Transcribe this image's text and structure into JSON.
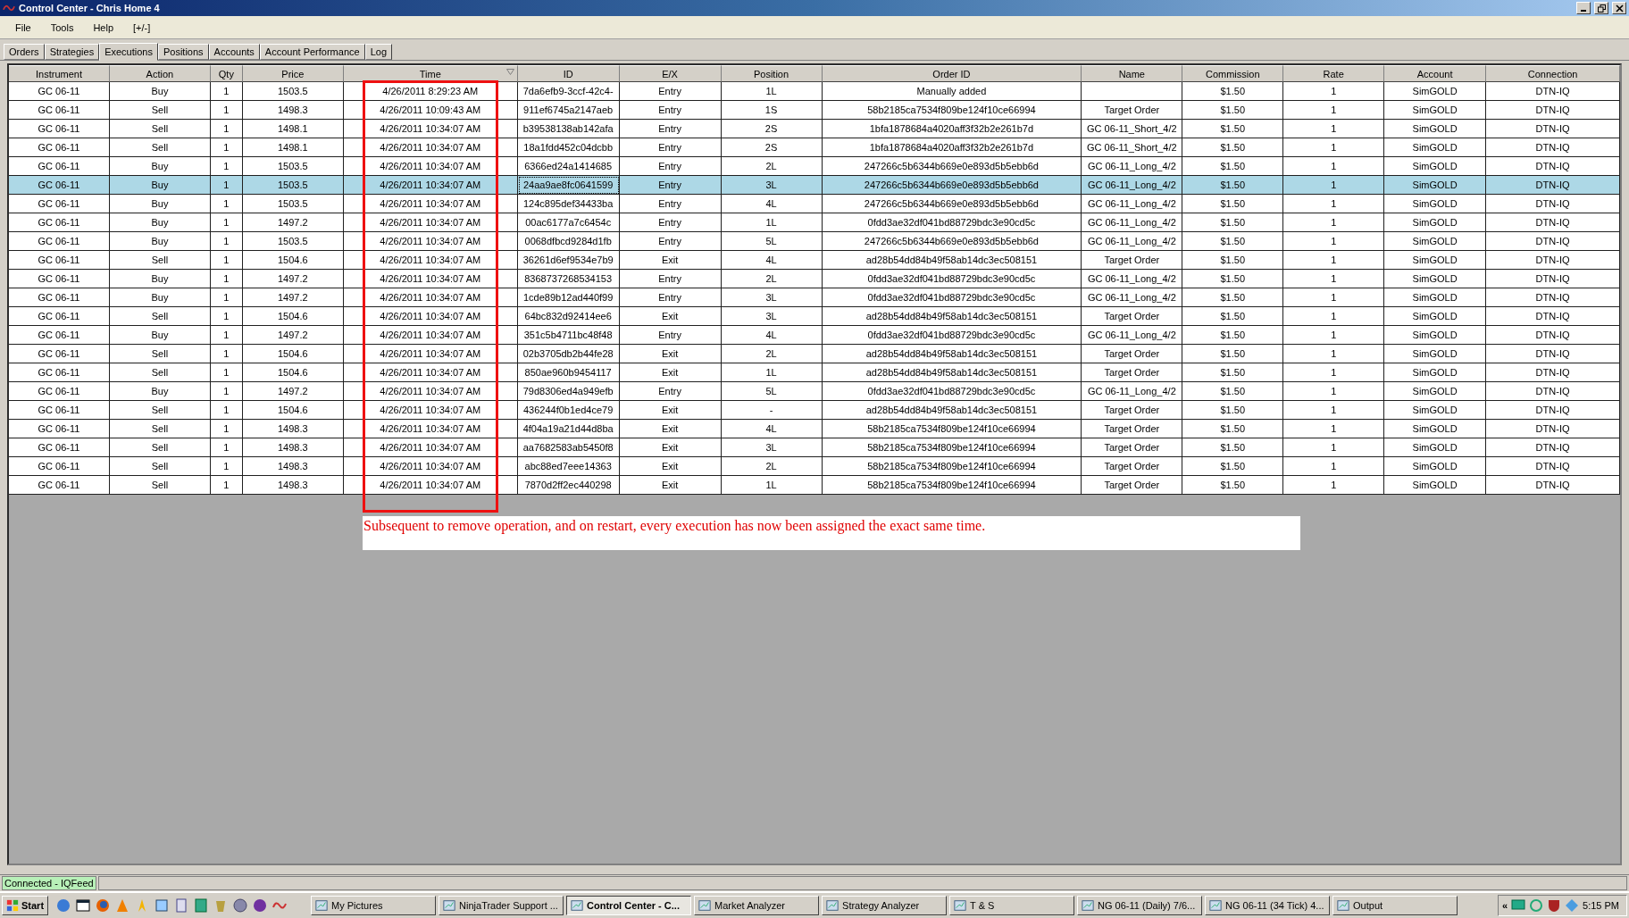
{
  "window": {
    "title": "Control Center - Chris Home 4"
  },
  "menu": [
    "File",
    "Tools",
    "Help",
    "[+/-]"
  ],
  "tabs": [
    {
      "label": "Orders",
      "selected": false
    },
    {
      "label": "Strategies",
      "selected": false
    },
    {
      "label": "Executions",
      "selected": true
    },
    {
      "label": "Positions",
      "selected": false
    },
    {
      "label": "Accounts",
      "selected": false
    },
    {
      "label": "Account Performance",
      "selected": false
    },
    {
      "label": "Log",
      "selected": false
    }
  ],
  "table": {
    "columns": [
      "Instrument",
      "Action",
      "Qty",
      "Price",
      "Time",
      "ID",
      "E/X",
      "Position",
      "Order ID",
      "Name",
      "Commission",
      "Rate",
      "Account",
      "Connection"
    ],
    "rows": [
      {
        "selected": false,
        "cells": [
          "GC 06-11",
          "Buy",
          "1",
          "1503.5",
          "4/26/2011 8:29:23 AM",
          "7da6efb9-3ccf-42c4-",
          "Entry",
          "1L",
          "Manually added",
          null,
          "$1.50",
          "1",
          "SimGOLD",
          "DTN-IQ"
        ]
      },
      {
        "selected": false,
        "cells": [
          "GC 06-11",
          "Sell",
          "1",
          "1498.3",
          "4/26/2011 10:09:43 AM",
          "911ef6745a2147aeb",
          "Entry",
          "1S",
          "58b2185ca7534f809be124f10ce66994",
          "Target Order",
          "$1.50",
          "1",
          "SimGOLD",
          "DTN-IQ"
        ]
      },
      {
        "selected": false,
        "cells": [
          "GC 06-11",
          "Sell",
          "1",
          "1498.1",
          "4/26/2011 10:34:07 AM",
          "b39538138ab142afa",
          "Entry",
          "2S",
          "1bfa1878684a4020aff3f32b2e261b7d",
          "GC 06-11_Short_4/2",
          "$1.50",
          "1",
          "SimGOLD",
          "DTN-IQ"
        ]
      },
      {
        "selected": false,
        "cells": [
          "GC 06-11",
          "Sell",
          "1",
          "1498.1",
          "4/26/2011 10:34:07 AM",
          "18a1fdd452c04dcbb",
          "Entry",
          "2S",
          "1bfa1878684a4020aff3f32b2e261b7d",
          "GC 06-11_Short_4/2",
          "$1.50",
          "1",
          "SimGOLD",
          "DTN-IQ"
        ]
      },
      {
        "selected": false,
        "cells": [
          "GC 06-11",
          "Buy",
          "1",
          "1503.5",
          "4/26/2011 10:34:07 AM",
          "6366ed24a1414685",
          "Entry",
          "2L",
          "247266c5b6344b669e0e893d5b5ebb6d",
          "GC 06-11_Long_4/2",
          "$1.50",
          "1",
          "SimGOLD",
          "DTN-IQ"
        ]
      },
      {
        "selected": true,
        "cells": [
          "GC 06-11",
          "Buy",
          "1",
          "1503.5",
          "4/26/2011 10:34:07 AM",
          "24aa9ae8fc0641599",
          "Entry",
          "3L",
          "247266c5b6344b669e0e893d5b5ebb6d",
          "GC 06-11_Long_4/2",
          "$1.50",
          "1",
          "SimGOLD",
          "DTN-IQ"
        ]
      },
      {
        "selected": false,
        "cells": [
          "GC 06-11",
          "Buy",
          "1",
          "1503.5",
          "4/26/2011 10:34:07 AM",
          "124c895def34433ba",
          "Entry",
          "4L",
          "247266c5b6344b669e0e893d5b5ebb6d",
          "GC 06-11_Long_4/2",
          "$1.50",
          "1",
          "SimGOLD",
          "DTN-IQ"
        ]
      },
      {
        "selected": false,
        "cells": [
          "GC 06-11",
          "Buy",
          "1",
          "1497.2",
          "4/26/2011 10:34:07 AM",
          "00ac6177a7c6454c",
          "Entry",
          "1L",
          "0fdd3ae32df041bd88729bdc3e90cd5c",
          "GC 06-11_Long_4/2",
          "$1.50",
          "1",
          "SimGOLD",
          "DTN-IQ"
        ]
      },
      {
        "selected": false,
        "cells": [
          "GC 06-11",
          "Buy",
          "1",
          "1503.5",
          "4/26/2011 10:34:07 AM",
          "0068dfbcd9284d1fb",
          "Entry",
          "5L",
          "247266c5b6344b669e0e893d5b5ebb6d",
          "GC 06-11_Long_4/2",
          "$1.50",
          "1",
          "SimGOLD",
          "DTN-IQ"
        ]
      },
      {
        "selected": false,
        "cells": [
          "GC 06-11",
          "Sell",
          "1",
          "1504.6",
          "4/26/2011 10:34:07 AM",
          "36261d6ef9534e7b9",
          "Exit",
          "4L",
          "ad28b54dd84b49f58ab14dc3ec508151",
          "Target Order",
          "$1.50",
          "1",
          "SimGOLD",
          "DTN-IQ"
        ]
      },
      {
        "selected": false,
        "cells": [
          "GC 06-11",
          "Buy",
          "1",
          "1497.2",
          "4/26/2011 10:34:07 AM",
          "8368737268534153",
          "Entry",
          "2L",
          "0fdd3ae32df041bd88729bdc3e90cd5c",
          "GC 06-11_Long_4/2",
          "$1.50",
          "1",
          "SimGOLD",
          "DTN-IQ"
        ]
      },
      {
        "selected": false,
        "cells": [
          "GC 06-11",
          "Buy",
          "1",
          "1497.2",
          "4/26/2011 10:34:07 AM",
          "1cde89b12ad440f99",
          "Entry",
          "3L",
          "0fdd3ae32df041bd88729bdc3e90cd5c",
          "GC 06-11_Long_4/2",
          "$1.50",
          "1",
          "SimGOLD",
          "DTN-IQ"
        ]
      },
      {
        "selected": false,
        "cells": [
          "GC 06-11",
          "Sell",
          "1",
          "1504.6",
          "4/26/2011 10:34:07 AM",
          "64bc832d92414ee6",
          "Exit",
          "3L",
          "ad28b54dd84b49f58ab14dc3ec508151",
          "Target Order",
          "$1.50",
          "1",
          "SimGOLD",
          "DTN-IQ"
        ]
      },
      {
        "selected": false,
        "cells": [
          "GC 06-11",
          "Buy",
          "1",
          "1497.2",
          "4/26/2011 10:34:07 AM",
          "351c5b4711bc48f48",
          "Entry",
          "4L",
          "0fdd3ae32df041bd88729bdc3e90cd5c",
          "GC 06-11_Long_4/2",
          "$1.50",
          "1",
          "SimGOLD",
          "DTN-IQ"
        ]
      },
      {
        "selected": false,
        "cells": [
          "GC 06-11",
          "Sell",
          "1",
          "1504.6",
          "4/26/2011 10:34:07 AM",
          "02b3705db2b44fe28",
          "Exit",
          "2L",
          "ad28b54dd84b49f58ab14dc3ec508151",
          "Target Order",
          "$1.50",
          "1",
          "SimGOLD",
          "DTN-IQ"
        ]
      },
      {
        "selected": false,
        "cells": [
          "GC 06-11",
          "Sell",
          "1",
          "1504.6",
          "4/26/2011 10:34:07 AM",
          "850ae960b9454117",
          "Exit",
          "1L",
          "ad28b54dd84b49f58ab14dc3ec508151",
          "Target Order",
          "$1.50",
          "1",
          "SimGOLD",
          "DTN-IQ"
        ]
      },
      {
        "selected": false,
        "cells": [
          "GC 06-11",
          "Buy",
          "1",
          "1497.2",
          "4/26/2011 10:34:07 AM",
          "79d8306ed4a949efb",
          "Entry",
          "5L",
          "0fdd3ae32df041bd88729bdc3e90cd5c",
          "GC 06-11_Long_4/2",
          "$1.50",
          "1",
          "SimGOLD",
          "DTN-IQ"
        ]
      },
      {
        "selected": false,
        "cells": [
          "GC 06-11",
          "Sell",
          "1",
          "1504.6",
          "4/26/2011 10:34:07 AM",
          "436244f0b1ed4ce79",
          "Exit",
          "-",
          "ad28b54dd84b49f58ab14dc3ec508151",
          "Target Order",
          "$1.50",
          "1",
          "SimGOLD",
          "DTN-IQ"
        ]
      },
      {
        "selected": false,
        "cells": [
          "GC 06-11",
          "Sell",
          "1",
          "1498.3",
          "4/26/2011 10:34:07 AM",
          "4f04a19a21d44d8ba",
          "Exit",
          "4L",
          "58b2185ca7534f809be124f10ce66994",
          "Target Order",
          "$1.50",
          "1",
          "SimGOLD",
          "DTN-IQ"
        ]
      },
      {
        "selected": false,
        "cells": [
          "GC 06-11",
          "Sell",
          "1",
          "1498.3",
          "4/26/2011 10:34:07 AM",
          "aa7682583ab5450f8",
          "Exit",
          "3L",
          "58b2185ca7534f809be124f10ce66994",
          "Target Order",
          "$1.50",
          "1",
          "SimGOLD",
          "DTN-IQ"
        ]
      },
      {
        "selected": false,
        "cells": [
          "GC 06-11",
          "Sell",
          "1",
          "1498.3",
          "4/26/2011 10:34:07 AM",
          "abc88ed7eee14363",
          "Exit",
          "2L",
          "58b2185ca7534f809be124f10ce66994",
          "Target Order",
          "$1.50",
          "1",
          "SimGOLD",
          "DTN-IQ"
        ]
      },
      {
        "selected": false,
        "cells": [
          "GC 06-11",
          "Sell",
          "1",
          "1498.3",
          "4/26/2011 10:34:07 AM",
          "7870d2ff2ec440298",
          "Exit",
          "1L",
          "58b2185ca7534f809be124f10ce66994",
          "Target Order",
          "$1.50",
          "1",
          "SimGOLD",
          "DTN-IQ"
        ]
      }
    ]
  },
  "annotation": "Subsequent to remove operation, and on restart, every execution has now been assigned the exact same time.",
  "status_bar": "Connected - IQFeed",
  "taskbar": {
    "start": "Start",
    "tasks": [
      {
        "label": "My Pictures",
        "selected": false
      },
      {
        "label": "NinjaTrader Support ...",
        "selected": false
      },
      {
        "label": "Control Center - C...",
        "selected": true
      },
      {
        "label": "Market Analyzer",
        "selected": false
      },
      {
        "label": "Strategy Analyzer",
        "selected": false
      },
      {
        "label": "T & S",
        "selected": false
      },
      {
        "label": "NG 06-11 (Daily)  7/6...",
        "selected": false
      },
      {
        "label": "NG 06-11 (34 Tick)  4...",
        "selected": false
      },
      {
        "label": "Output",
        "selected": false
      }
    ],
    "tray_expand": "«",
    "clock": "5:15 PM"
  }
}
